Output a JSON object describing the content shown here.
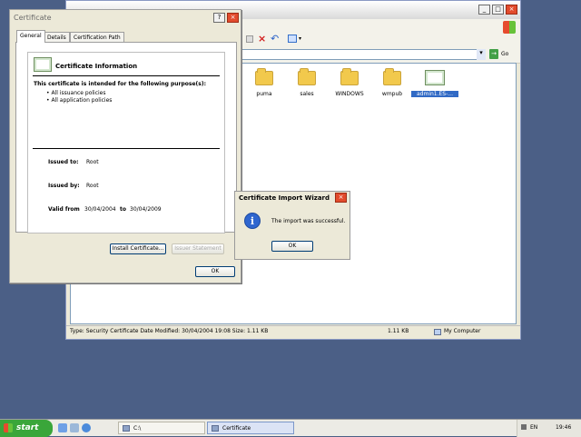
{
  "explorer": {
    "title": "",
    "toolbar": {
      "go_label": "Go"
    },
    "files": [
      {
        "label": "puma",
        "icon": "folder-icon"
      },
      {
        "label": "sales",
        "icon": "folder-icon"
      },
      {
        "label": "WINDOWS",
        "icon": "folder-icon"
      },
      {
        "label": "wmpub",
        "icon": "folder-icon"
      },
      {
        "label": "admin1.ES-...",
        "icon": "certificate-file-icon"
      }
    ],
    "status": {
      "info": "Type: Security Certificate Date Modified: 30/04/2004 19:08 Size: 1.11 KB",
      "size": "1.11 KB",
      "zone": "My Computer"
    }
  },
  "cert_dialog": {
    "title": "Certificate",
    "tabs": [
      "General",
      "Details",
      "Certification Path"
    ],
    "heading": "Certificate Information",
    "purpose_label": "This certificate is intended for the following purpose(s):",
    "purposes": [
      "All issuance policies",
      "All application policies"
    ],
    "issued_to_label": "Issued to:",
    "issued_to_value": "Root",
    "issued_by_label": "Issued by:",
    "issued_by_value": "Root",
    "valid_from_label": "Valid from",
    "valid_from_value": "30/04/2004",
    "valid_to_label": "to",
    "valid_to_value": "30/04/2009",
    "install_button": "Install Certificate...",
    "issuer_button": "Issuer Statement",
    "ok_button": "OK"
  },
  "wizard": {
    "title": "Certificate Import Wizard",
    "message": "The import was successful.",
    "ok_button": "OK"
  },
  "taskbar": {
    "start_label": "start",
    "tasks": [
      {
        "label": "C:\\"
      },
      {
        "label": "Certificate"
      }
    ],
    "language": "EN",
    "clock": "19:46"
  }
}
